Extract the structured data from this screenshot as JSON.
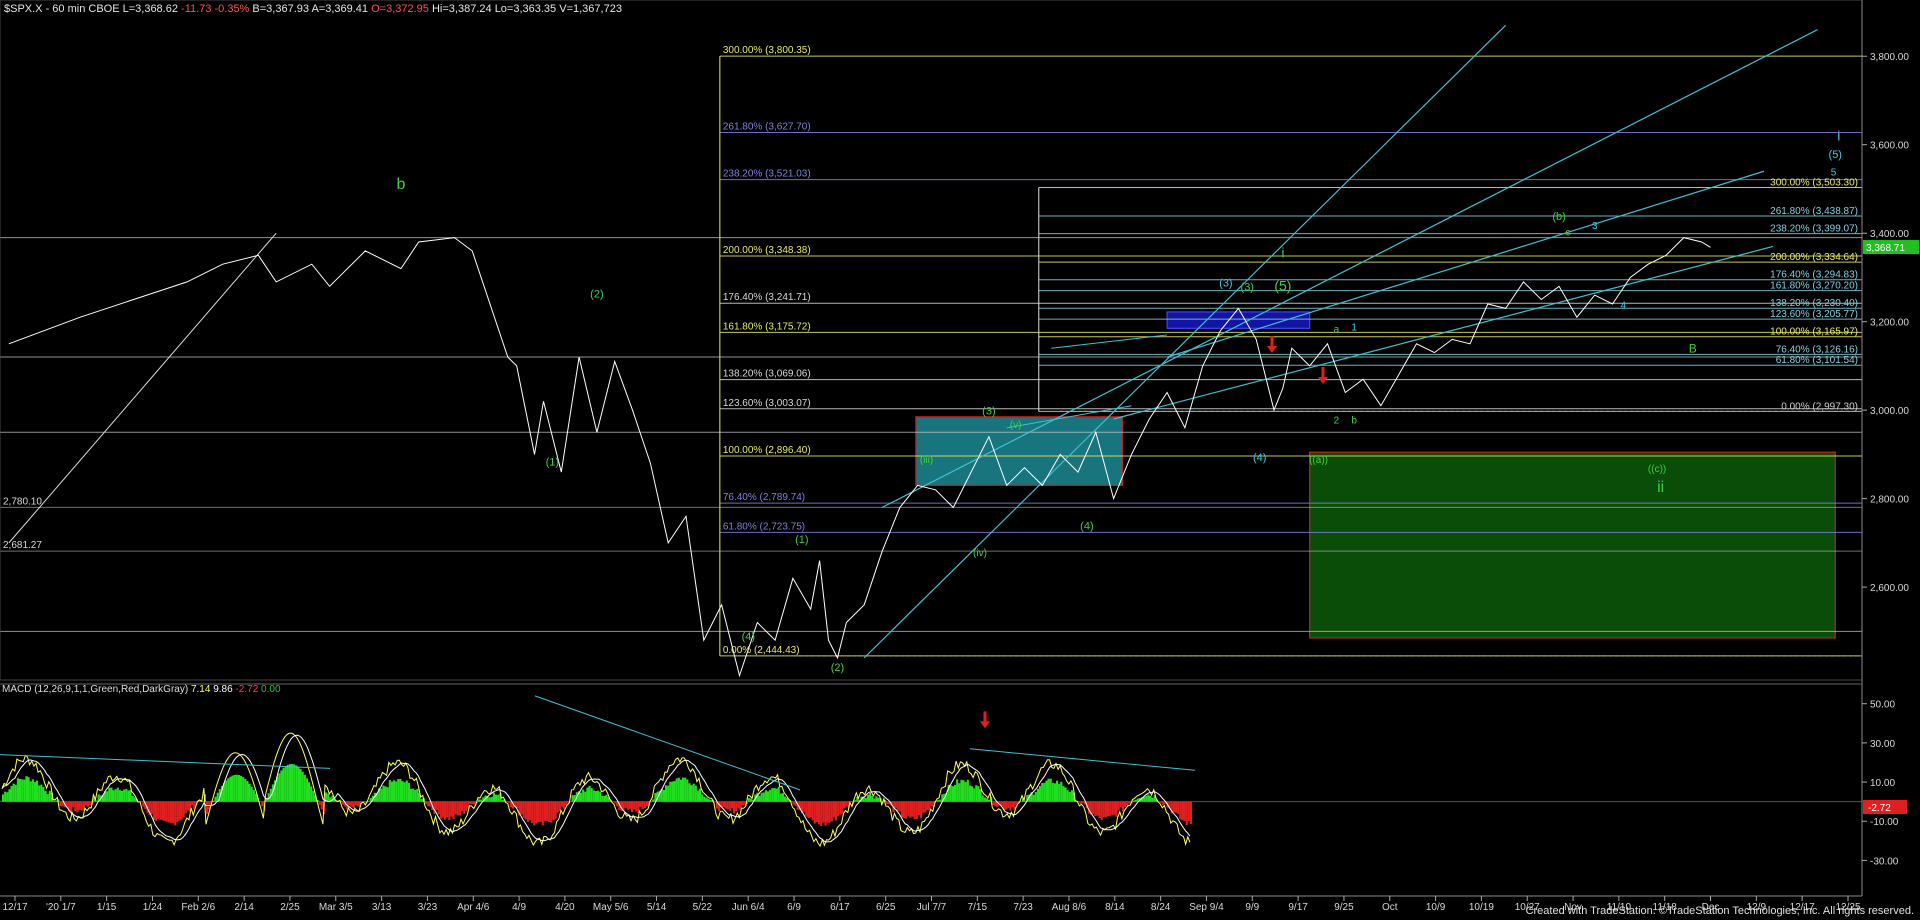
{
  "header": {
    "symbol": "$SPX.X - 60 min  CBOE",
    "last": "L=3,368.62",
    "change": "-11.73",
    "change_pct": "-0.35%",
    "bid": "B=3,367.93",
    "ask": "A=3,369.41",
    "open": "O=3,372.95",
    "high": "Hi=3,387.24",
    "low": "Lo=3,363.35",
    "volume": "V=1,367,723"
  },
  "macd_header": {
    "label": "MACD (12,26,9,1,1,Green,Red,DarkGray)",
    "v1": "7.14",
    "v2": "9.86",
    "v3": "-2.72",
    "v4": "0.00"
  },
  "credit": "Created with TradeStation. ©TradeStation Technologies, Inc. All rights reserved.",
  "colors": {
    "background": "#000000",
    "price": "#ffffff",
    "fib_yellow": "#e8e870",
    "fib_blue": "#8080e0",
    "fib_cyan": "#80d0e0",
    "wave_green": "#40d040",
    "wave_cyan": "#40c8e0",
    "channel": "#40c0d0",
    "macd_pos": "#20e020",
    "macd_neg": "#e02020",
    "arrow_red": "#e02020"
  },
  "chart_data": [
    {
      "type": "line",
      "name": "$SPX.X 60 min",
      "y_ticks": [
        "3,800.00",
        "3,600.00",
        "3,400.00",
        "3,200.00",
        "3,000.00",
        "2,800.00",
        "2,600.00"
      ],
      "y_tick_values": [
        3800,
        3600,
        3400,
        3200,
        3000,
        2800,
        2600
      ],
      "ylim": [
        2390,
        3900
      ],
      "last_price_tag": "3,368.71",
      "x_ticks": [
        "12/17",
        "'20 1/7",
        "1/15",
        "1/24",
        "Feb 2/6",
        "2/14",
        "2/25",
        "Mar 3/5",
        "3/13",
        "3/23",
        "Apr 4/6",
        "4/9",
        "4/20",
        "May 5/6",
        "5/14",
        "5/22",
        "Jun 6/4",
        "6/9",
        "6/17",
        "6/25",
        "Jul 7/7",
        "7/15",
        "7/23",
        "Aug 8/6",
        "8/14",
        "8/24",
        "Sep 9/4",
        "9/9",
        "9/17",
        "9/25",
        "Oct",
        "10/9",
        "10/19",
        "10/27",
        "Nov",
        "11/10",
        "11/18",
        "Dec",
        "12/9",
        "12/17",
        "12/25"
      ],
      "price_path": [
        [
          2019.96,
          3150
        ],
        [
          2020.0,
          3210
        ],
        [
          2020.03,
          3250
        ],
        [
          2020.06,
          3290
        ],
        [
          2020.08,
          3330
        ],
        [
          2020.1,
          3350
        ],
        [
          2020.11,
          3290
        ],
        [
          2020.13,
          3330
        ],
        [
          2020.14,
          3280
        ],
        [
          2020.16,
          3360
        ],
        [
          2020.18,
          3320
        ],
        [
          2020.19,
          3380
        ],
        [
          2020.21,
          3390
        ],
        [
          2020.22,
          3360
        ],
        [
          2020.24,
          3120
        ],
        [
          2020.245,
          3100
        ],
        [
          2020.255,
          2900
        ],
        [
          2020.26,
          3020
        ],
        [
          2020.27,
          2860
        ],
        [
          2020.28,
          3120
        ],
        [
          2020.29,
          2950
        ],
        [
          2020.3,
          3110
        ],
        [
          2020.31,
          3000
        ],
        [
          2020.32,
          2880
        ],
        [
          2020.33,
          2700
        ],
        [
          2020.34,
          2760
        ],
        [
          2020.35,
          2480
        ],
        [
          2020.36,
          2560
        ],
        [
          2020.37,
          2400
        ],
        [
          2020.38,
          2520
        ],
        [
          2020.39,
          2480
        ],
        [
          2020.4,
          2620
        ],
        [
          2020.41,
          2550
        ],
        [
          2020.415,
          2660
        ],
        [
          2020.42,
          2480
        ],
        [
          2020.425,
          2440
        ],
        [
          2020.43,
          2520
        ],
        [
          2020.44,
          2560
        ],
        [
          2020.45,
          2680
        ],
        [
          2020.46,
          2780
        ],
        [
          2020.47,
          2830
        ],
        [
          2020.48,
          2820
        ],
        [
          2020.49,
          2780
        ],
        [
          2020.5,
          2860
        ],
        [
          2020.51,
          2940
        ],
        [
          2020.52,
          2830
        ],
        [
          2020.53,
          2870
        ],
        [
          2020.54,
          2830
        ],
        [
          2020.55,
          2900
        ],
        [
          2020.56,
          2860
        ],
        [
          2020.57,
          2950
        ],
        [
          2020.58,
          2800
        ],
        [
          2020.59,
          2900
        ],
        [
          2020.6,
          2980
        ],
        [
          2020.61,
          3040
        ],
        [
          2020.62,
          2960
        ],
        [
          2020.63,
          3100
        ],
        [
          2020.64,
          3180
        ],
        [
          2020.65,
          3230
        ],
        [
          2020.66,
          3160
        ],
        [
          2020.67,
          3000
        ],
        [
          2020.675,
          3050
        ],
        [
          2020.68,
          3140
        ],
        [
          2020.69,
          3100
        ],
        [
          2020.7,
          3150
        ],
        [
          2020.71,
          3040
        ],
        [
          2020.72,
          3070
        ],
        [
          2020.73,
          3010
        ],
        [
          2020.74,
          3080
        ],
        [
          2020.75,
          3150
        ],
        [
          2020.76,
          3130
        ],
        [
          2020.77,
          3160
        ],
        [
          2020.78,
          3150
        ],
        [
          2020.79,
          3240
        ],
        [
          2020.8,
          3230
        ],
        [
          2020.81,
          3290
        ],
        [
          2020.82,
          3250
        ],
        [
          2020.83,
          3280
        ],
        [
          2020.84,
          3210
        ],
        [
          2020.85,
          3260
        ],
        [
          2020.86,
          3240
        ],
        [
          2020.87,
          3300
        ],
        [
          2020.88,
          3330
        ],
        [
          2020.89,
          3350
        ],
        [
          2020.9,
          3390
        ],
        [
          2020.91,
          3380
        ],
        [
          2020.915,
          3368
        ]
      ],
      "fib_levels_left": [
        {
          "label": "300.00% (3,800.35)",
          "value": 3800.35
        },
        {
          "label": "261.80% (3,627.70)",
          "value": 3627.7
        },
        {
          "label": "238.20% (3,521.03)",
          "value": 3521.03
        },
        {
          "label": "200.00% (3,348.38)",
          "value": 3348.38
        },
        {
          "label": "176.40% (3,241.71)",
          "value": 3241.71
        },
        {
          "label": "161.80% (3,175.72)",
          "value": 3175.72
        },
        {
          "label": "138.20% (3,069.06)",
          "value": 3069.06
        },
        {
          "label": "123.60% (3,003.07)",
          "value": 3003.07
        },
        {
          "label": "100.00% (2,896.40)",
          "value": 2896.4
        },
        {
          "label": "76.40% (2,789.74)",
          "value": 2789.74
        },
        {
          "label": "61.80% (2,723.75)",
          "value": 2723.75
        },
        {
          "label": "0.00% (2,444.43)",
          "value": 2444.43
        }
      ],
      "fib_levels_right": [
        {
          "label": "300.00% (3,503.30)",
          "value": 3503.3
        },
        {
          "label": "261.80% (3,438.87)",
          "value": 3438.87
        },
        {
          "label": "238.20% (3,399.07)",
          "value": 3399.07
        },
        {
          "label": "200.00% (3,334.64)",
          "value": 3334.64
        },
        {
          "label": "176.40% (3,294.83)",
          "value": 3294.83
        },
        {
          "label": "161.80% (3,270.20)",
          "value": 3270.2
        },
        {
          "label": "138.20% (3,230.40)",
          "value": 3230.4
        },
        {
          "label": "123.60% (3,205.77)",
          "value": 3205.77
        },
        {
          "label": "100.00% (3,165.97)",
          "value": 3165.97
        },
        {
          "label": "76.40% (3,126.16)",
          "value": 3126.16
        },
        {
          "label": "61.80% (3,101.54)",
          "value": 3101.54
        },
        {
          "label": "0.00% (2,997.30)",
          "value": 2997.3
        }
      ],
      "other_levels": [
        {
          "label": "2,780.10",
          "value": 2780.1
        },
        {
          "label": "2,681.27",
          "value": 2681.27
        }
      ],
      "wave_labels_green": [
        "b",
        "(2)",
        "(1)",
        "(1)",
        "(4)",
        "(2)",
        "(3)",
        "(iii)",
        "(v)",
        "(iv)",
        "(4)",
        "(3)",
        "(5)",
        "i",
        "((a))",
        "a",
        "2",
        "b",
        "(b)",
        "c",
        "B",
        "((c))",
        "ii"
      ],
      "wave_labels_cyan": [
        "(3)",
        "(4)",
        "1",
        "3",
        "4",
        "(5)",
        "5",
        "i"
      ],
      "boxes": [
        {
          "name": "cyan-support-box",
          "y_range": [
            2830,
            2985
          ]
        },
        {
          "name": "blue-box",
          "y_range": [
            3185,
            3222
          ]
        },
        {
          "name": "green-target-box",
          "y_range": [
            2485,
            2905
          ]
        }
      ]
    },
    {
      "type": "bar",
      "name": "MACD (12,26,9,1,1,Green,Red,DarkGray)",
      "y_ticks": [
        "50.00",
        "30.00",
        "10.00",
        "-10.00",
        "-30.00"
      ],
      "y_tick_values": [
        50,
        30,
        10,
        -10,
        -30
      ],
      "ylim": [
        -40,
        57
      ],
      "last_value_tag": "-2.72"
    }
  ]
}
